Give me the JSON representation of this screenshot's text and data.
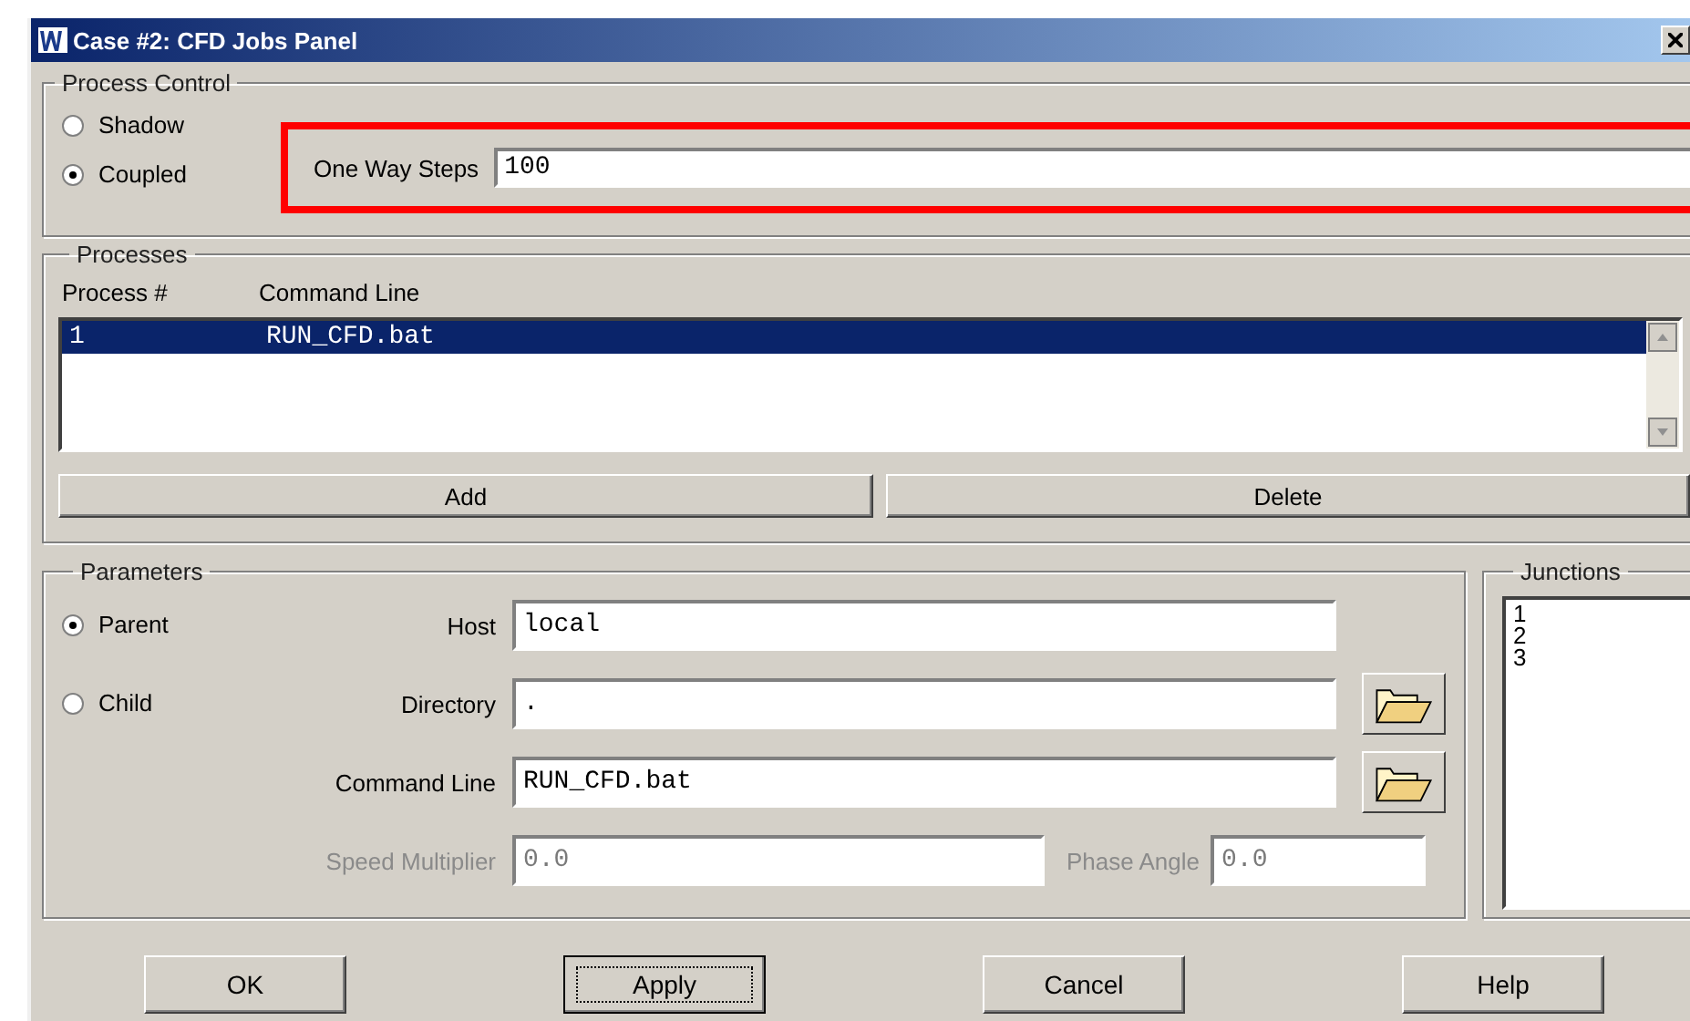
{
  "window": {
    "title": "Case #2: CFD Jobs Panel"
  },
  "process_control": {
    "legend": "Process Control",
    "modes": [
      {
        "label": "Shadow",
        "selected": false
      },
      {
        "label": "Coupled",
        "selected": true
      }
    ],
    "one_way_steps": {
      "label": "One Way Steps",
      "value": "100",
      "highlighted": true
    }
  },
  "processes": {
    "legend": "Processes",
    "columns": [
      "Process #",
      "Command Line"
    ],
    "rows": [
      {
        "cells": [
          "1",
          "RUN_CFD.bat"
        ],
        "selected": true
      }
    ],
    "buttons": [
      "Add",
      "Delete"
    ]
  },
  "parameters": {
    "legend": "Parameters",
    "roles": [
      {
        "label": "Parent",
        "selected": true
      },
      {
        "label": "Child",
        "selected": false
      }
    ],
    "fields": [
      {
        "label": "Host",
        "value": "local",
        "browse": false,
        "disabled": false
      },
      {
        "label": "Directory",
        "value": ".",
        "browse": true,
        "disabled": false
      },
      {
        "label": "Command Line",
        "value": "RUN_CFD.bat",
        "browse": true,
        "disabled": false
      }
    ],
    "speed_multiplier": {
      "label": "Speed Multiplier",
      "value": "0.0",
      "disabled": true
    },
    "phase_angle": {
      "label": "Phase Angle",
      "value": "0.0",
      "disabled": true
    }
  },
  "junctions": {
    "legend": "Junctions",
    "items": [
      "1",
      "2",
      "3"
    ]
  },
  "buttons": [
    {
      "label": "OK",
      "focused": false
    },
    {
      "label": "Apply",
      "focused": true
    },
    {
      "label": "Cancel",
      "focused": false
    },
    {
      "label": "Help",
      "focused": false
    }
  ]
}
